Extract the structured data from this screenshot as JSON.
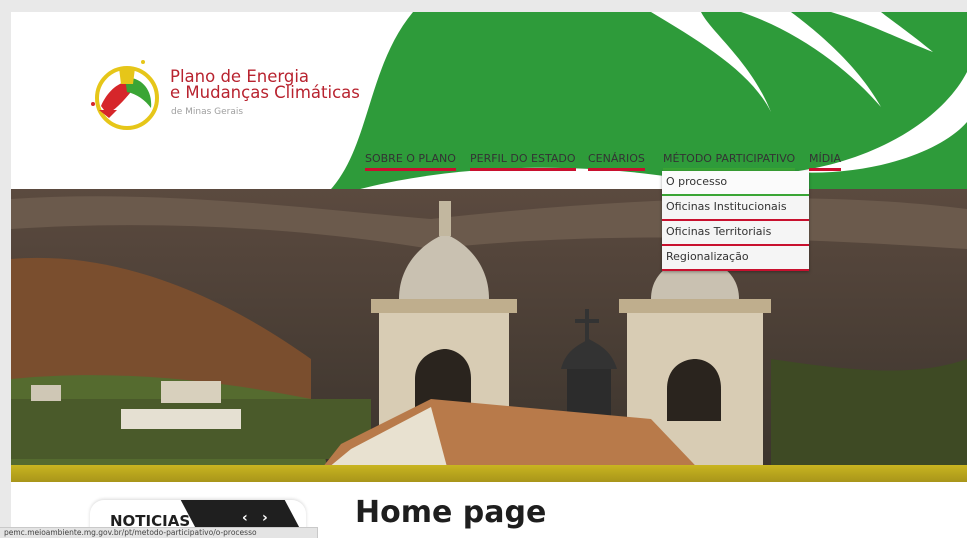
{
  "brand": {
    "title_line1": "Plano de Energia",
    "title_line2": "e Mudanças Climáticas",
    "subtitle": "de Minas Gerais"
  },
  "nav": {
    "items": [
      {
        "label": "SOBRE O PLANO"
      },
      {
        "label": "PERFIL DO ESTADO"
      },
      {
        "label": "CENÁRIOS"
      },
      {
        "label": "MÉTODO PARTICIPATIVO"
      },
      {
        "label": "MÍDIA"
      }
    ]
  },
  "dropdown": {
    "items": [
      {
        "label": "O processo"
      },
      {
        "label": "Oficinas Institucionais"
      },
      {
        "label": "Oficinas Territoriais"
      },
      {
        "label": "Regionalização"
      }
    ]
  },
  "news": {
    "label": "NOTICIAS",
    "prev": "‹",
    "next": "›"
  },
  "main": {
    "title": "Home page"
  },
  "statusbar": {
    "url": "pemc.meioambiente.mg.gov.br/pt/metodo-participativo/o-processo"
  },
  "colors": {
    "brand_red": "#c8102e",
    "brand_green": "#3aa535",
    "dark": "#1f1f1f"
  }
}
